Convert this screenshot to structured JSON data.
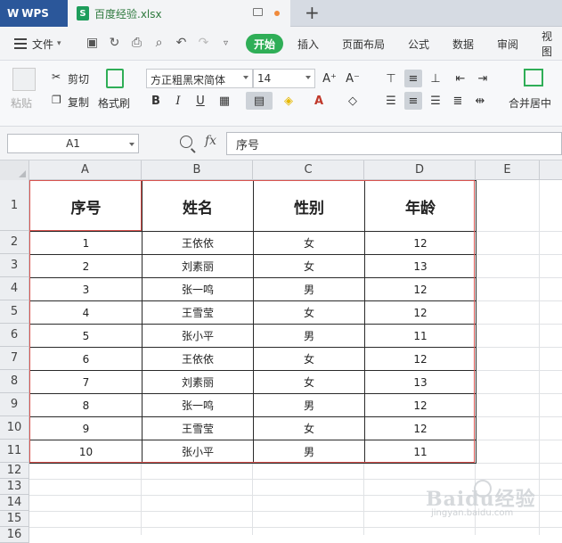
{
  "app": {
    "brand": "WPS",
    "file_name": "百度经验.xlsx",
    "new_tab": "+"
  },
  "menu": {
    "file": "文件",
    "start": "开始",
    "tabs": [
      "插入",
      "页面布局",
      "公式",
      "数据",
      "审阅",
      "视图"
    ]
  },
  "ribbon": {
    "paste": "粘贴",
    "cut": "剪切",
    "copy": "复制",
    "format_painter": "格式刷",
    "font_name": "方正粗黑宋简体",
    "font_size": "14",
    "grow_font": "A⁺",
    "shrink_font": "A⁻",
    "bold": "B",
    "italic": "I",
    "underline": "U",
    "merge_center": "合并居中"
  },
  "formula": {
    "name_box": "A1",
    "fx": "fx",
    "content": "序号"
  },
  "columns": [
    "A",
    "B",
    "C",
    "D",
    "E"
  ],
  "rows": [
    "1",
    "2",
    "3",
    "4",
    "5",
    "6",
    "7",
    "8",
    "9",
    "10",
    "11",
    "12",
    "13",
    "14",
    "15",
    "16"
  ],
  "table": {
    "headers": [
      "序号",
      "姓名",
      "性别",
      "年龄"
    ],
    "rows": [
      [
        "1",
        "王依依",
        "女",
        "12"
      ],
      [
        "2",
        "刘素丽",
        "女",
        "13"
      ],
      [
        "3",
        "张一鸣",
        "男",
        "12"
      ],
      [
        "4",
        "王雪莹",
        "女",
        "12"
      ],
      [
        "5",
        "张小平",
        "男",
        "11"
      ],
      [
        "6",
        "王依依",
        "女",
        "12"
      ],
      [
        "7",
        "刘素丽",
        "女",
        "13"
      ],
      [
        "8",
        "张一鸣",
        "男",
        "12"
      ],
      [
        "9",
        "王雪莹",
        "女",
        "12"
      ],
      [
        "10",
        "张小平",
        "男",
        "11"
      ]
    ]
  },
  "watermark": {
    "main": "Baidu经验",
    "sub": "jingyan.baidu.com"
  },
  "colors": {
    "accent_green": "#2fae57",
    "wps_blue": "#2b579a",
    "border_red": "#d9534f"
  }
}
